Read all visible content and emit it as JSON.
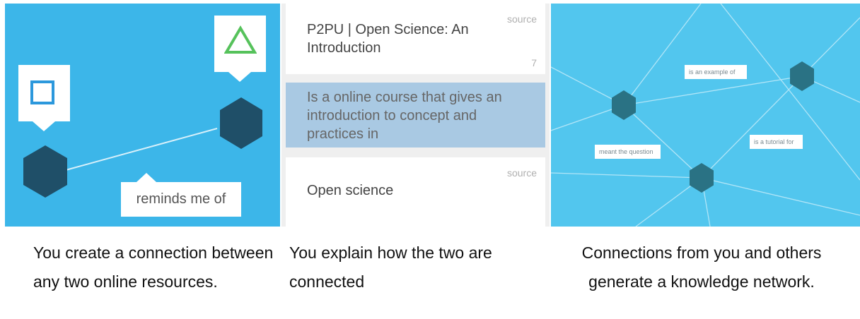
{
  "panel1": {
    "label": "reminds me of",
    "colors": {
      "background": "#3cb6e9",
      "hexagon": "#1f4f68",
      "square": "#2c98dc",
      "triangle": "#56c25b"
    }
  },
  "panel2": {
    "top_card": {
      "source": "source",
      "title": "P2PU | Open Science: An Introduction",
      "count": "7"
    },
    "middle_card": {
      "text": "Is a online course that gives an introduction to concept and practices in"
    },
    "bottom_card": {
      "source": "source",
      "title": "Open science"
    },
    "colors": {
      "highlight": "#a9c9e3"
    }
  },
  "panel3": {
    "labels": [
      "is an example of",
      "meant the question",
      "is a tutorial for"
    ],
    "colors": {
      "background": "#52c6ee",
      "hexagon": "#2a7284"
    }
  },
  "captions": [
    "You create a connection between any two online resources.",
    "You explain how the two are connected",
    "Connections from you and others generate a knowledge network."
  ]
}
